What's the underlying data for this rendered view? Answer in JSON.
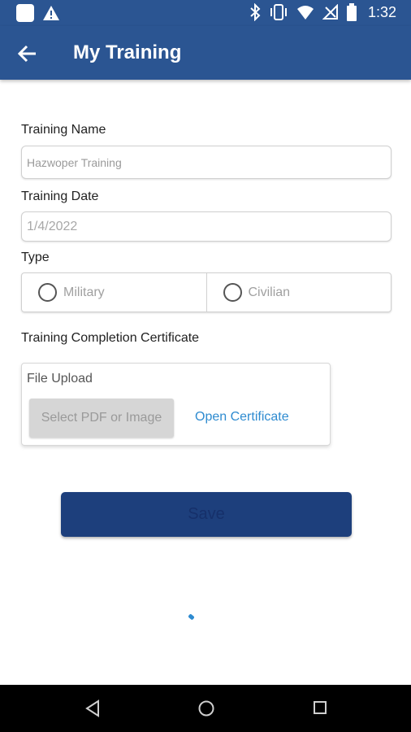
{
  "status_bar": {
    "time": "1:32",
    "icons_left": [
      "app-notification-icon",
      "warning-icon"
    ],
    "icons_right": [
      "bluetooth-icon",
      "vibrate-icon",
      "wifi-icon",
      "no-signal-icon",
      "battery-icon"
    ]
  },
  "app_bar": {
    "title": "My Training",
    "background": "#2b5592"
  },
  "form": {
    "training_name": {
      "label": "Training Name",
      "placeholder": "Hazwoper Training"
    },
    "training_date": {
      "label": "Training Date",
      "value": "1/4/2022"
    },
    "type": {
      "label": "Type",
      "options": [
        "Military",
        "Civilian"
      ],
      "selected": null
    },
    "certificate": {
      "label": "Training Completion Certificate",
      "upload_title": "File Upload",
      "select_button": "Select PDF or Image",
      "open_link": "Open Certificate"
    },
    "save_button": "Save"
  },
  "colors": {
    "primary": "#2b5592",
    "save_button": "#1d3f7c",
    "link": "#2e8bd0"
  },
  "nav_bar": {
    "buttons": [
      "back-nav-icon",
      "home-nav-icon",
      "recents-nav-icon"
    ]
  }
}
